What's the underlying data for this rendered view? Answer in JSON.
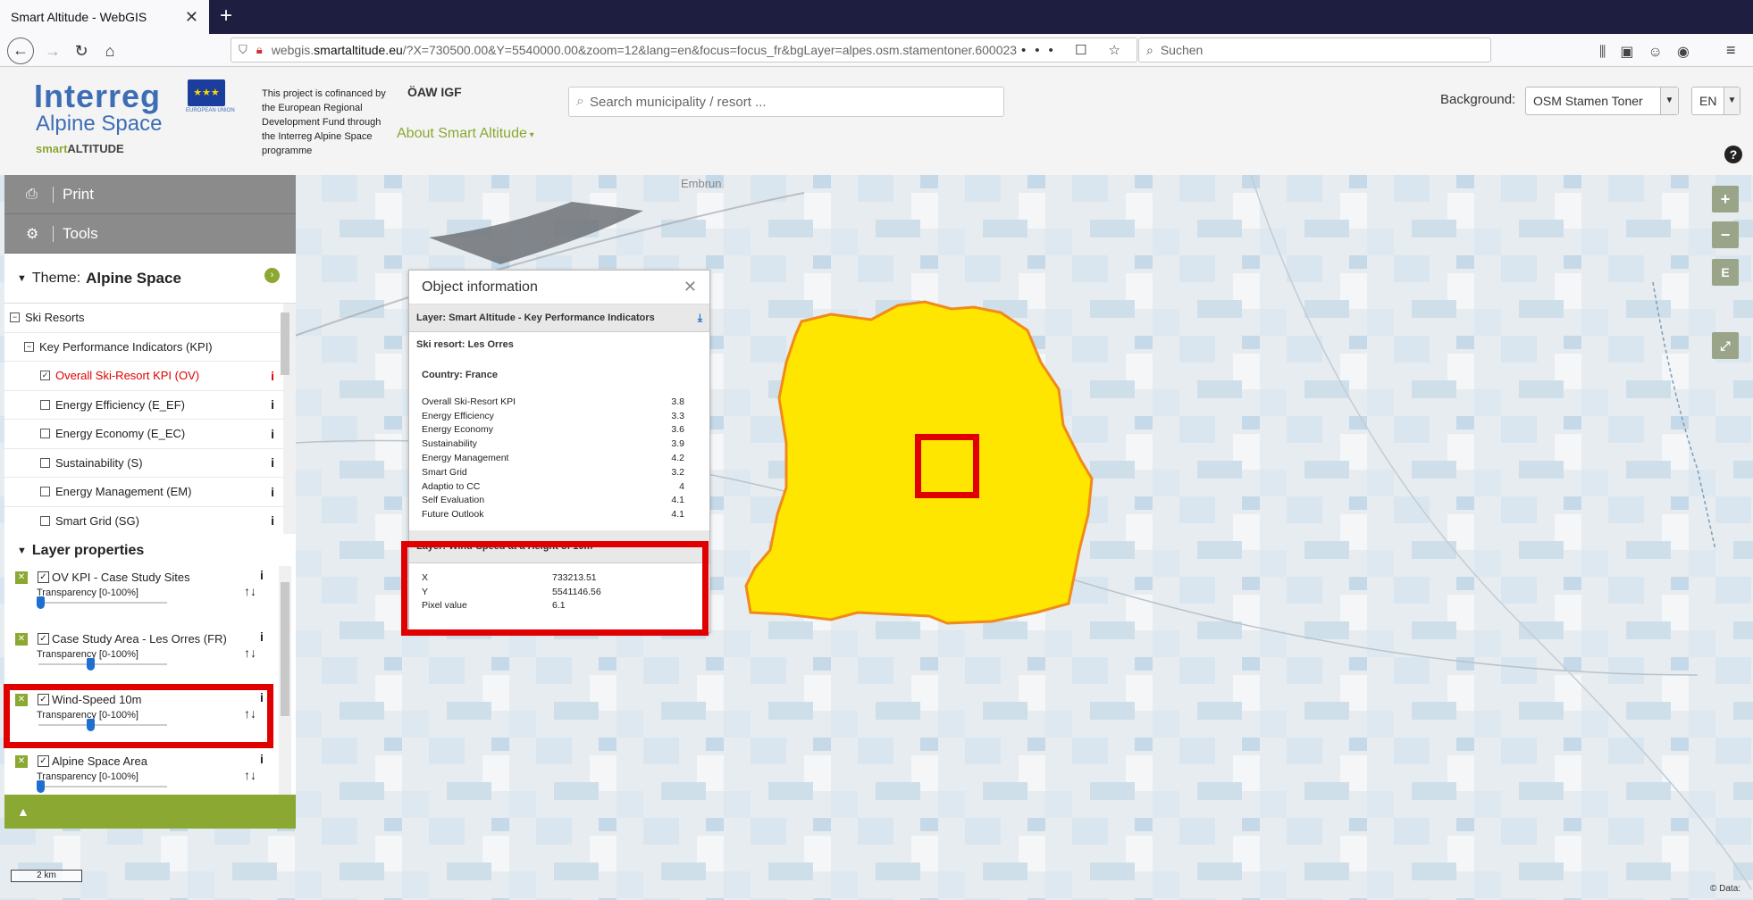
{
  "browser": {
    "tab_title": "Smart Altitude - WebGIS",
    "tab_close": "✕",
    "new_tab": "+",
    "url_domain": "smartaltitude.eu",
    "url_prefix": "webgis.",
    "url_rest": "/?X=730500.00&Y=5540000.00&zoom=12&lang=en&focus=focus_fr&bgLayer=alpes.osm.stamentoner.600023",
    "url_actions": "••• ☐ ☆",
    "search_placeholder": "Suchen"
  },
  "header": {
    "logo_main": "Interreg",
    "logo_sub": "Alpine Space",
    "logo_eu_label": "EUROPEAN UNION",
    "logo_smart": "smart",
    "logo_altitude": "ALTITUDE",
    "cofinance_text": "This project is cofinanced by the European Regional Development Fund through the Interreg Alpine Space programme",
    "partner_logo": "ÖAW IGF",
    "about_link": "About Smart Altitude",
    "search_placeholder": "Search municipality / resort ...",
    "background_label": "Background:",
    "background_value": "OSM Stamen Toner",
    "language_value": "EN",
    "help": "?"
  },
  "map": {
    "place_label": "Embrun",
    "scale_label": "2 km",
    "attribution": "© Data:",
    "zoom_in": "+",
    "zoom_out": "−",
    "extent": "E",
    "fullscreen": "⤢"
  },
  "sidebar": {
    "print_label": "Print",
    "tools_label": "Tools",
    "theme_prefix": "Theme:",
    "theme_name": "Alpine Space",
    "tree": [
      {
        "label": "Ski Resorts",
        "type": "group"
      },
      {
        "label": "Key Performance Indicators (KPI)",
        "type": "group"
      },
      {
        "label": "Overall Ski-Resort KPI (OV)",
        "type": "item",
        "checked": true,
        "active": true
      },
      {
        "label": "Energy Efficiency (E_EF)",
        "type": "item",
        "checked": false
      },
      {
        "label": "Energy Economy (E_EC)",
        "type": "item",
        "checked": false
      },
      {
        "label": "Sustainability (S)",
        "type": "item",
        "checked": false
      },
      {
        "label": "Energy Management (EM)",
        "type": "item",
        "checked": false
      },
      {
        "label": "Smart Grid (SG)",
        "type": "item",
        "checked": false
      }
    ],
    "layer_properties_label": "Layer properties",
    "transparency_label": "Transparency [0-100%]",
    "layers": [
      {
        "name": "OV KPI - Case Study Sites",
        "transparency": 0
      },
      {
        "name": "Case Study Area - Les Orres (FR)",
        "transparency": 40
      },
      {
        "name": "Wind-Speed 10m",
        "transparency": 40
      },
      {
        "name": "Alpine Space Area",
        "transparency": 0
      }
    ],
    "footer_icon": "▲"
  },
  "popup": {
    "title": "Object information",
    "layer1_title": "Layer: Smart Altitude - Key Performance Indicators",
    "resort": "Ski resort: Les Orres",
    "country": "Country: France",
    "kpis": [
      {
        "name": "Overall Ski-Resort KPI",
        "value": "3.8"
      },
      {
        "name": "Energy Efficiency",
        "value": "3.3"
      },
      {
        "name": "Energy Economy",
        "value": "3.6"
      },
      {
        "name": "Sustainability",
        "value": "3.9"
      },
      {
        "name": "Energy Management",
        "value": "4.2"
      },
      {
        "name": "Smart Grid",
        "value": "3.2"
      },
      {
        "name": "Adaptio to CC",
        "value": "4"
      },
      {
        "name": "Self Evaluation",
        "value": "4.1"
      },
      {
        "name": "Future Outlook",
        "value": "4.1"
      }
    ],
    "layer2_title": "Layer: Wind-Speed at a Height of 10m",
    "pixel_info": [
      {
        "name": "X",
        "value": "733213.51"
      },
      {
        "name": "Y",
        "value": "5541146.56"
      },
      {
        "name": "Pixel value",
        "value": "6.1"
      }
    ]
  },
  "colors": {
    "accent_green": "#8aa832",
    "highlight_red": "#e10000",
    "resort_fill": "#ffe600",
    "resort_stroke": "#f08a1c"
  }
}
